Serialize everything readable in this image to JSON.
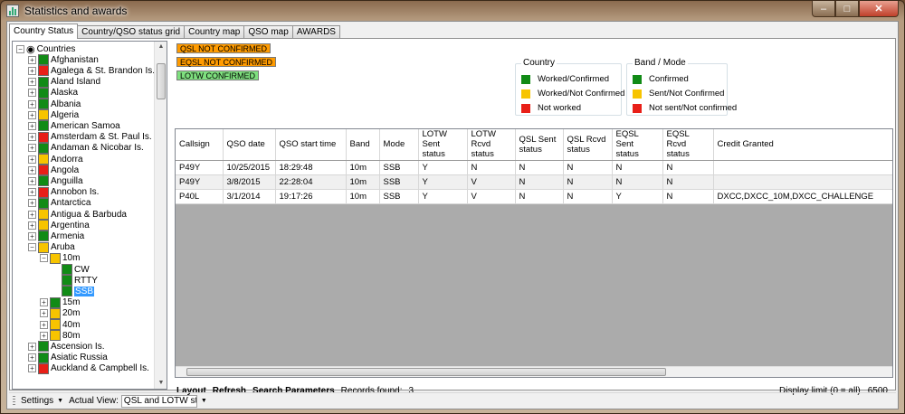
{
  "window": {
    "title": "Statistics and awards",
    "min": "–",
    "max": "□",
    "close": "✕"
  },
  "tabs": [
    "Country Status",
    "Country/QSO status grid",
    "Country map",
    "QSO map",
    "AWARDS"
  ],
  "tree": {
    "root": "Countries",
    "countries": [
      {
        "name": "Afghanistan",
        "status": "g"
      },
      {
        "name": "Agalega & St. Brandon Is.",
        "status": "r"
      },
      {
        "name": "Aland Island",
        "status": "g"
      },
      {
        "name": "Alaska",
        "status": "g"
      },
      {
        "name": "Albania",
        "status": "g"
      },
      {
        "name": "Algeria",
        "status": "y"
      },
      {
        "name": "American Samoa",
        "status": "g"
      },
      {
        "name": "Amsterdam & St. Paul Is.",
        "status": "r"
      },
      {
        "name": "Andaman & Nicobar Is.",
        "status": "g"
      },
      {
        "name": "Andorra",
        "status": "y"
      },
      {
        "name": "Angola",
        "status": "r"
      },
      {
        "name": "Anguilla",
        "status": "g"
      },
      {
        "name": "Annobon Is.",
        "status": "r"
      },
      {
        "name": "Antarctica",
        "status": "g"
      },
      {
        "name": "Antigua & Barbuda",
        "status": "y"
      },
      {
        "name": "Argentina",
        "status": "y"
      },
      {
        "name": "Armenia",
        "status": "g"
      },
      {
        "name": "Aruba",
        "status": "y",
        "expanded": true
      }
    ],
    "aruba_bands": [
      {
        "name": "10m",
        "status": "y",
        "modes": [
          {
            "name": "CW",
            "status": "g"
          },
          {
            "name": "RTTY",
            "status": "g"
          },
          {
            "name": "SSB",
            "status": "g",
            "selected": true
          }
        ]
      },
      {
        "name": "15m",
        "status": "g"
      },
      {
        "name": "20m",
        "status": "y"
      },
      {
        "name": "40m",
        "status": "y"
      },
      {
        "name": "80m",
        "status": "y"
      }
    ],
    "countries_after": [
      {
        "name": "Ascension Is.",
        "status": "g"
      },
      {
        "name": "Asiatic Russia",
        "status": "g"
      },
      {
        "name": "Auckland & Campbell Is.",
        "status": "r"
      }
    ]
  },
  "statuses": [
    {
      "label": "QSL NOT CONFIRMED",
      "color": "#ff9b00"
    },
    {
      "label": "EQSL NOT CONFIRMED",
      "color": "#ff9b00"
    },
    {
      "label": "LOTW CONFIRMED",
      "color": "#7ee07e"
    }
  ],
  "legend_country": {
    "title": "Country",
    "items": [
      {
        "label": "Worked/Confirmed",
        "color": "#118b16"
      },
      {
        "label": "Worked/Not Confirmed",
        "color": "#f7c400"
      },
      {
        "label": "Not worked",
        "color": "#e81f18"
      }
    ]
  },
  "legend_band": {
    "title": "Band / Mode",
    "items": [
      {
        "label": "Confirmed",
        "color": "#118b16"
      },
      {
        "label": "Sent/Not Confirmed",
        "color": "#f7c400"
      },
      {
        "label": "Not sent/Not confirmed",
        "color": "#e81f18"
      }
    ]
  },
  "table": {
    "columns": [
      "Callsign",
      "QSO date",
      "QSO start time",
      "Band",
      "Mode",
      "LOTW Sent status",
      "LOTW Rcvd status",
      "QSL Sent status",
      "QSL Rcvd status",
      "EQSL Sent status",
      "EQSL Rcvd status",
      "Credit Granted"
    ],
    "rows": [
      [
        "P49Y",
        "10/25/2015",
        "18:29:48",
        "10m",
        "SSB",
        "Y",
        "N",
        "N",
        "N",
        "N",
        "N",
        ""
      ],
      [
        "P49Y",
        "3/8/2015",
        "22:28:04",
        "10m",
        "SSB",
        "Y",
        "V",
        "N",
        "N",
        "N",
        "N",
        ""
      ],
      [
        "P40L",
        "3/1/2014",
        "19:17:26",
        "10m",
        "SSB",
        "Y",
        "V",
        "N",
        "N",
        "Y",
        "N",
        "DXCC,DXCC_10M,DXCC_CHALLENGE"
      ]
    ]
  },
  "bottom": {
    "layout": "Layout",
    "refresh": "Refresh",
    "search": "Search Parameters",
    "records_label": "Records found:",
    "records_value": "3",
    "limit_label": "Display limit (0 = all)",
    "limit_value": "6500"
  },
  "toolstrip": {
    "settings": "Settings",
    "actual_view_label": "Actual View:",
    "actual_view_value": "QSL and LOTW sta"
  }
}
